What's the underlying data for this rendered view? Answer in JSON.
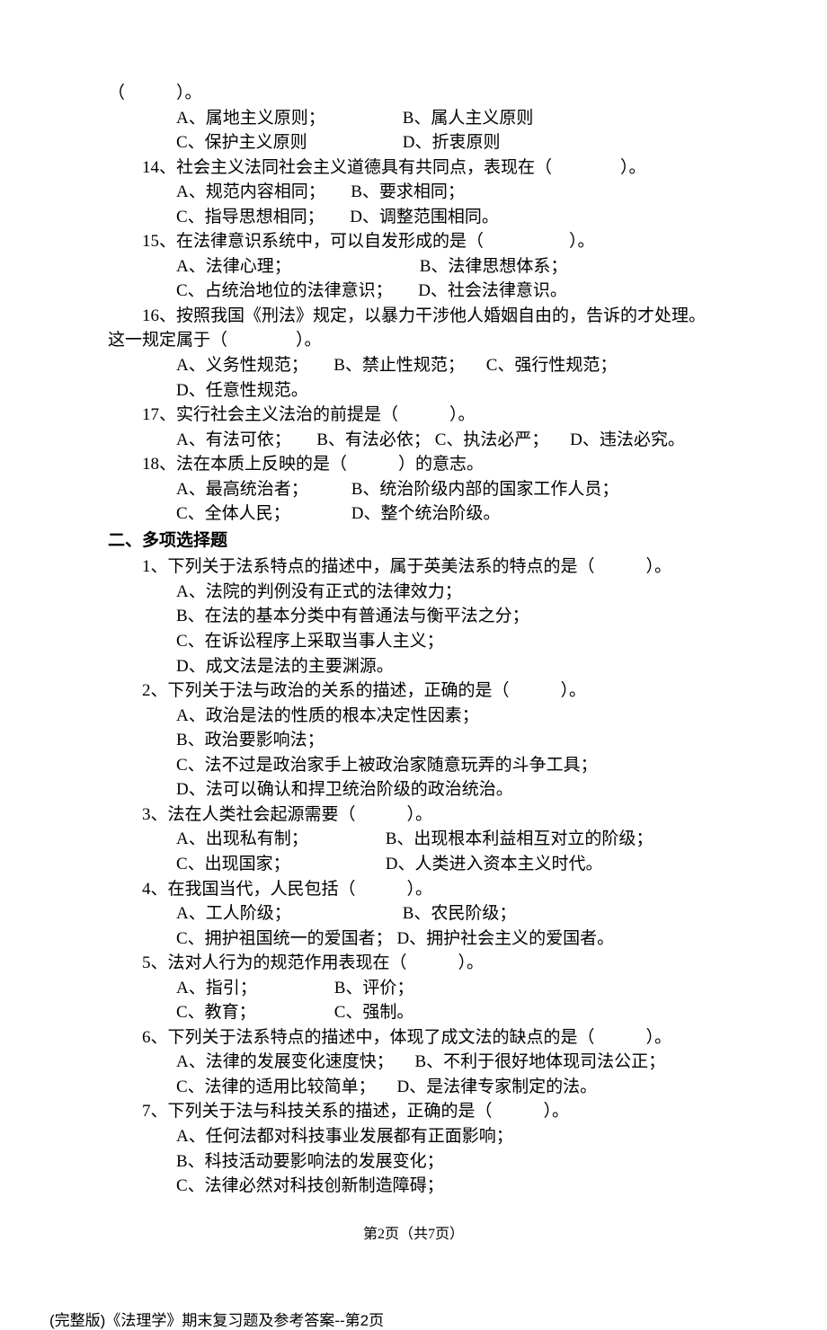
{
  "q13": {
    "tail": "（　　　）。",
    "a": "A、属地主义原则；",
    "b": "B、属人主义原则",
    "c": "C、保护主义原则",
    "d": "D、折衷原则"
  },
  "q14": {
    "stem": "14、社会主义法同社会主义道德具有共同点，表现在（　　　　）。",
    "a": "A、规范内容相同；",
    "b": "B、要求相同；",
    "c": "C、指导思想相同；",
    "d": "D、调整范围相同。"
  },
  "q15": {
    "stem": "15、在法律意识系统中，可以自发形成的是（　　　　　）。",
    "a": "A、法律心理；",
    "b": "B、法律思想体系；",
    "c": "C、占统治地位的法律意识；",
    "d": "D、社会法律意识。"
  },
  "q16": {
    "stem1": "16、按照我国《刑法》规定，以暴力干涉他人婚姻自由的，告诉的才处理。",
    "stem2": "这一规定属于（　　　　）。",
    "a": "A、义务性规范；",
    "b": "B、禁止性规范；",
    "c": "　C、强行性规范；",
    "d": "D、任意性规范。"
  },
  "q17": {
    "stem": "17、实行社会主义法治的前提是（　　　）。",
    "a": "A、有法可依；",
    "b": "B、有法必依；",
    "c": "C、执法必严；",
    "d": "　D、违法必究。"
  },
  "q18": {
    "stem": "18、法在本质上反映的是（　　　）的意志。",
    "a": "A、最高统治者；",
    "b": "B、统治阶级内部的国家工作人员；",
    "c": "C、全体人民；",
    "d": "D、整个统治阶级。"
  },
  "section2": "二、多项选择题",
  "m1": {
    "stem": "1、下列关于法系特点的描述中，属于英美法系的特点的是（　　　）。",
    "a": "A、法院的判例没有正式的法律效力；",
    "b": "B、在法的基本分类中有普通法与衡平法之分；",
    "c": "C、在诉讼程序上采取当事人主义；",
    "d": "D、成文法是法的主要渊源。"
  },
  "m2": {
    "stem": "2、下列关于法与政治的关系的描述，正确的是（　　　）。",
    "a": "A、政治是法的性质的根本决定性因素；",
    "b": "B、政治要影响法；",
    "c": "C、法不过是政治家手上被政治家随意玩弄的斗争工具；",
    "d": "D、法可以确认和捍卫统治阶级的政治统治。"
  },
  "m3": {
    "stem": "3、法在人类社会起源需要（　　　）。",
    "a": "A、出现私有制；",
    "b": "B、出现根本利益相互对立的阶级；",
    "c": "C、出现国家；",
    "d": "D、人类进入资本主义时代。"
  },
  "m4": {
    "stem": "4、在我国当代，人民包括（　　　）。",
    "a": "A、工人阶级；",
    "b": "B、农民阶级；",
    "c": "C、拥护祖国统一的爱国者；",
    "d": "D、拥护社会主义的爱国者。"
  },
  "m5": {
    "stem": "5、法对人行为的规范作用表现在（　　　）。",
    "a": "A、指引；",
    "b": "B、评价；",
    "c": "C、教育；",
    "d": "C、强制。"
  },
  "m6": {
    "stem": "6、下列关于法系特点的描述中，体现了成文法的缺点的是（　　　）。",
    "a": "A、法律的发展变化速度快；",
    "b": "　B、不利于很好地体现司法公正；",
    "c": "C、法律的适用比较简单；",
    "d": " 　D、是法律专家制定的法。"
  },
  "m7": {
    "stem": "7、下列关于法与科技关系的描述，正确的是（　　　）。",
    "a": "A、任何法都对科技事业发展都有正面影响；",
    "b": "B、科技活动要影响法的发展变化；",
    "c": "C、法律必然对科技创新制造障碍；"
  },
  "footer_page": "第2页（共7页）",
  "footer_doc": "(完整版)《法理学》期末复习题及参考答案--第2页"
}
